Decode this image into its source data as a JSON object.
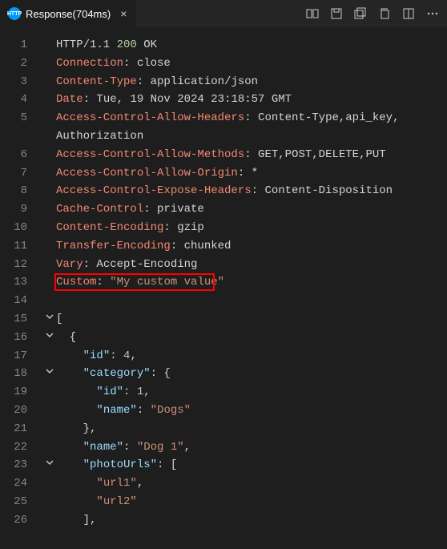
{
  "tab": {
    "label": "Response(704ms)"
  },
  "toolbar_icons": [
    "diff-view-icon",
    "save-icon",
    "save-all-icon",
    "copy-icon",
    "split-icon",
    "more-icon"
  ],
  "lines": [
    {
      "num": 1,
      "fold": "",
      "tokens": [
        [
          "plain",
          "HTTP/1.1 "
        ],
        [
          "number",
          "200"
        ],
        [
          "plain",
          " OK"
        ]
      ]
    },
    {
      "num": 2,
      "fold": "",
      "tokens": [
        [
          "red",
          "Connection"
        ],
        [
          "plain",
          ": close"
        ]
      ]
    },
    {
      "num": 3,
      "fold": "",
      "tokens": [
        [
          "red",
          "Content-Type"
        ],
        [
          "plain",
          ": application/json"
        ]
      ]
    },
    {
      "num": 4,
      "fold": "",
      "tokens": [
        [
          "red",
          "Date"
        ],
        [
          "plain",
          ": Tue, 19 Nov 2024 23:18:57 GMT"
        ]
      ]
    },
    {
      "num": 5,
      "fold": "",
      "tokens": [
        [
          "red",
          "Access-Control-Allow-Headers"
        ],
        [
          "plain",
          ": Content-Type,api_key,"
        ]
      ]
    },
    {
      "num": "",
      "fold": "",
      "tokens": [
        [
          "plain",
          "Authorization"
        ]
      ]
    },
    {
      "num": 6,
      "fold": "",
      "tokens": [
        [
          "red",
          "Access-Control-Allow-Methods"
        ],
        [
          "plain",
          ": GET,POST,DELETE,PUT"
        ]
      ]
    },
    {
      "num": 7,
      "fold": "",
      "tokens": [
        [
          "red",
          "Access-Control-Allow-Origin"
        ],
        [
          "plain",
          ": *"
        ]
      ]
    },
    {
      "num": 8,
      "fold": "",
      "tokens": [
        [
          "red",
          "Access-Control-Expose-Headers"
        ],
        [
          "plain",
          ": Content-Disposition"
        ]
      ]
    },
    {
      "num": 9,
      "fold": "",
      "tokens": [
        [
          "red",
          "Cache-Control"
        ],
        [
          "plain",
          ": private"
        ]
      ]
    },
    {
      "num": 10,
      "fold": "",
      "tokens": [
        [
          "red",
          "Content-Encoding"
        ],
        [
          "plain",
          ": gzip"
        ]
      ]
    },
    {
      "num": 11,
      "fold": "",
      "tokens": [
        [
          "red",
          "Transfer-Encoding"
        ],
        [
          "plain",
          ": chunked"
        ]
      ]
    },
    {
      "num": 12,
      "fold": "",
      "tokens": [
        [
          "red",
          "Vary"
        ],
        [
          "plain",
          ": Accept-Encoding"
        ]
      ]
    },
    {
      "num": 13,
      "fold": "",
      "highlight": true,
      "highlight_width": 200,
      "tokens": [
        [
          "red",
          "Custom"
        ],
        [
          "plain",
          ": "
        ],
        [
          "string",
          "\"My custom value\""
        ]
      ]
    },
    {
      "num": 14,
      "fold": "",
      "tokens": []
    },
    {
      "num": 15,
      "fold": "v",
      "tokens": [
        [
          "punct",
          "["
        ]
      ]
    },
    {
      "num": 16,
      "fold": "v",
      "tokens": [
        [
          "punct",
          "  {"
        ]
      ]
    },
    {
      "num": 17,
      "fold": "",
      "tokens": [
        [
          "plain",
          "    "
        ],
        [
          "key",
          "\"id\""
        ],
        [
          "punct",
          ": "
        ],
        [
          "number",
          "4"
        ],
        [
          "punct",
          ","
        ]
      ]
    },
    {
      "num": 18,
      "fold": "v",
      "tokens": [
        [
          "plain",
          "    "
        ],
        [
          "key",
          "\"category\""
        ],
        [
          "punct",
          ": {"
        ]
      ]
    },
    {
      "num": 19,
      "fold": "",
      "tokens": [
        [
          "plain",
          "      "
        ],
        [
          "key",
          "\"id\""
        ],
        [
          "punct",
          ": "
        ],
        [
          "number",
          "1"
        ],
        [
          "punct",
          ","
        ]
      ]
    },
    {
      "num": 20,
      "fold": "",
      "tokens": [
        [
          "plain",
          "      "
        ],
        [
          "key",
          "\"name\""
        ],
        [
          "punct",
          ": "
        ],
        [
          "string",
          "\"Dogs\""
        ]
      ]
    },
    {
      "num": 21,
      "fold": "",
      "tokens": [
        [
          "punct",
          "    },"
        ]
      ]
    },
    {
      "num": 22,
      "fold": "",
      "tokens": [
        [
          "plain",
          "    "
        ],
        [
          "key",
          "\"name\""
        ],
        [
          "punct",
          ": "
        ],
        [
          "string",
          "\"Dog 1\""
        ],
        [
          "punct",
          ","
        ]
      ]
    },
    {
      "num": 23,
      "fold": "v",
      "tokens": [
        [
          "plain",
          "    "
        ],
        [
          "key",
          "\"photoUrls\""
        ],
        [
          "punct",
          ": ["
        ]
      ]
    },
    {
      "num": 24,
      "fold": "",
      "tokens": [
        [
          "plain",
          "      "
        ],
        [
          "string",
          "\"url1\""
        ],
        [
          "punct",
          ","
        ]
      ]
    },
    {
      "num": 25,
      "fold": "",
      "tokens": [
        [
          "plain",
          "      "
        ],
        [
          "string",
          "\"url2\""
        ]
      ]
    },
    {
      "num": 26,
      "fold": "",
      "tokens": [
        [
          "punct",
          "    ],"
        ]
      ]
    }
  ]
}
